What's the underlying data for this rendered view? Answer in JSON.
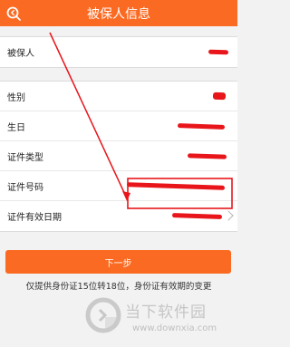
{
  "header": {
    "title": "被保人信息",
    "back_icon": "search-back-icon"
  },
  "sections": {
    "insured": {
      "label": "被保人"
    },
    "details": {
      "items": [
        {
          "label": "性别"
        },
        {
          "label": "生日"
        },
        {
          "label": "证件类型"
        },
        {
          "label": "证件号码"
        },
        {
          "label": "证件有效日期"
        }
      ]
    }
  },
  "actions": {
    "next_label": "下一步"
  },
  "hint": "仅提供身份证15位转18位，身份证有效期的变更",
  "watermark": {
    "name": "当下软件园",
    "url": "www.downxia.com"
  },
  "colors": {
    "accent": "#fb6a22",
    "annotation": "#e8161b"
  }
}
